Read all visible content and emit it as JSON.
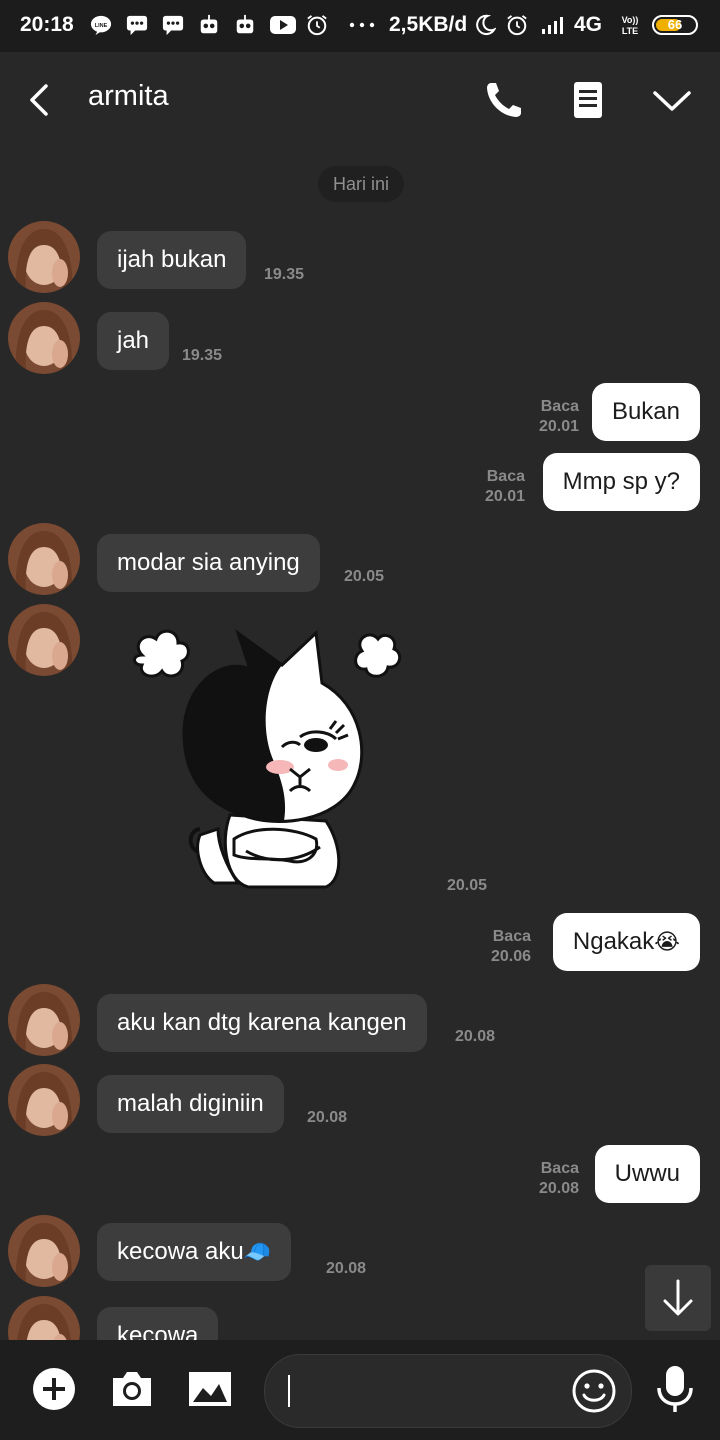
{
  "status_bar": {
    "time": "20:18",
    "net_speed": "2,5KB/d",
    "network": "4G",
    "battery": "66",
    "icons": [
      "line-icon",
      "chat-icon",
      "chat-icon",
      "robot-icon",
      "robot-icon",
      "youtube-icon",
      "alarm-icon",
      "more-icon",
      "moon-icon",
      "alarm-icon",
      "signal-icon",
      "volte-icon",
      "battery-icon"
    ]
  },
  "header": {
    "contact_name": "armita",
    "icons": [
      "back-icon",
      "phone-icon",
      "notes-icon",
      "chevron-down-icon"
    ]
  },
  "date_separator": "Hari ini",
  "messages": [
    {
      "dir": "in",
      "text": "ijah bukan",
      "time": "19.35"
    },
    {
      "dir": "in",
      "text": "jah",
      "time": "19.35"
    },
    {
      "dir": "out",
      "text": "Bukan",
      "read": "Baca",
      "time": "20.01"
    },
    {
      "dir": "out",
      "text": "Mmp sp y?",
      "read": "Baca",
      "time": "20.01"
    },
    {
      "dir": "in",
      "text": "modar sia anying",
      "time": "20.05"
    },
    {
      "dir": "in",
      "sticker": "angry-cat-sticker",
      "time": "20.05"
    },
    {
      "dir": "out",
      "text": "Ngakak",
      "emoji": "😭",
      "read": "Baca",
      "time": "20.06"
    },
    {
      "dir": "in",
      "text": "aku kan dtg karena kangen",
      "time": "20.08"
    },
    {
      "dir": "in",
      "text": "malah diginiin",
      "time": "20.08"
    },
    {
      "dir": "out",
      "text": "Uwwu",
      "read": "Baca",
      "time": "20.08"
    },
    {
      "dir": "in",
      "text": "kecowa aku",
      "emoji": "🧢",
      "time": "20.08"
    },
    {
      "dir": "in",
      "text": "kecowa"
    }
  ],
  "bottom_bar": {
    "icons": [
      "add-icon",
      "camera-icon",
      "gallery-icon",
      "emoji-icon",
      "mic-icon"
    ],
    "input_value": ""
  },
  "colors": {
    "background": "#282828",
    "incoming_bubble": "#3d3d3d",
    "outgoing_bubble": "#ffffff",
    "timestamp": "#8a8a8a"
  }
}
